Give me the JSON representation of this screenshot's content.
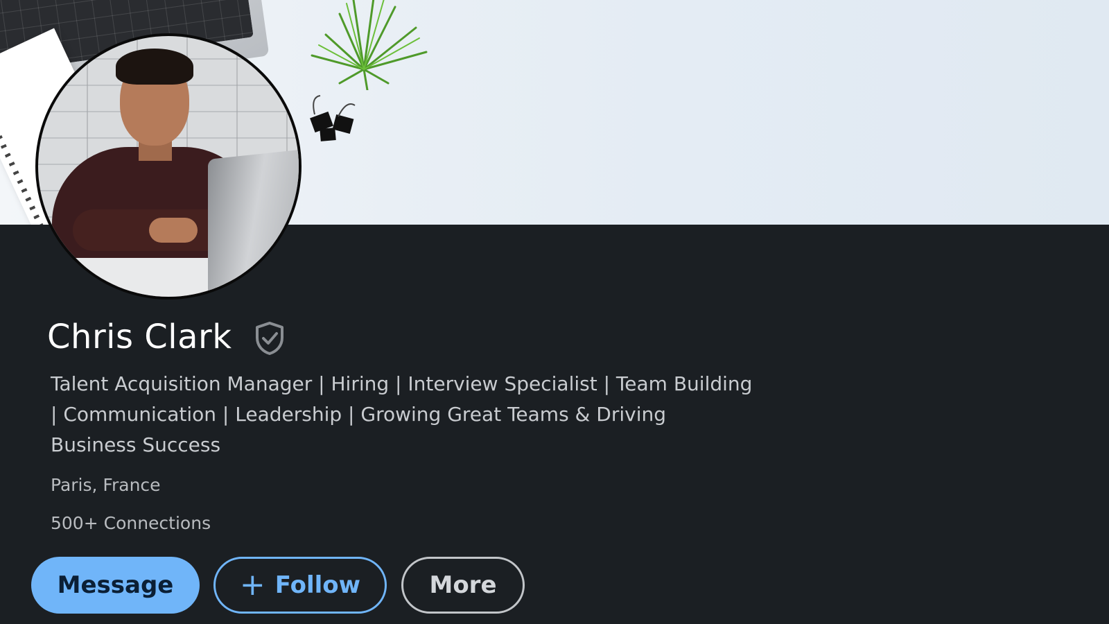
{
  "profile": {
    "name": "Chris Clark",
    "headline": "Talent Acquisition Manager | Hiring | Interview Specialist | Team Building | Communication | Leadership | Growing Great Teams & Driving Business Success",
    "location": "Paris, France",
    "connections": "500+ Connections",
    "verified_icon": "verified-shield-icon"
  },
  "actions": {
    "message_label": "Message",
    "follow_label": "Follow",
    "follow_icon": "+",
    "more_label": "More"
  },
  "colors": {
    "accent": "#70b5f9",
    "background": "#1b1f23",
    "banner": "#e4ecf4",
    "name_text": "#ffffff",
    "secondary_text": "#c9ccd0"
  }
}
